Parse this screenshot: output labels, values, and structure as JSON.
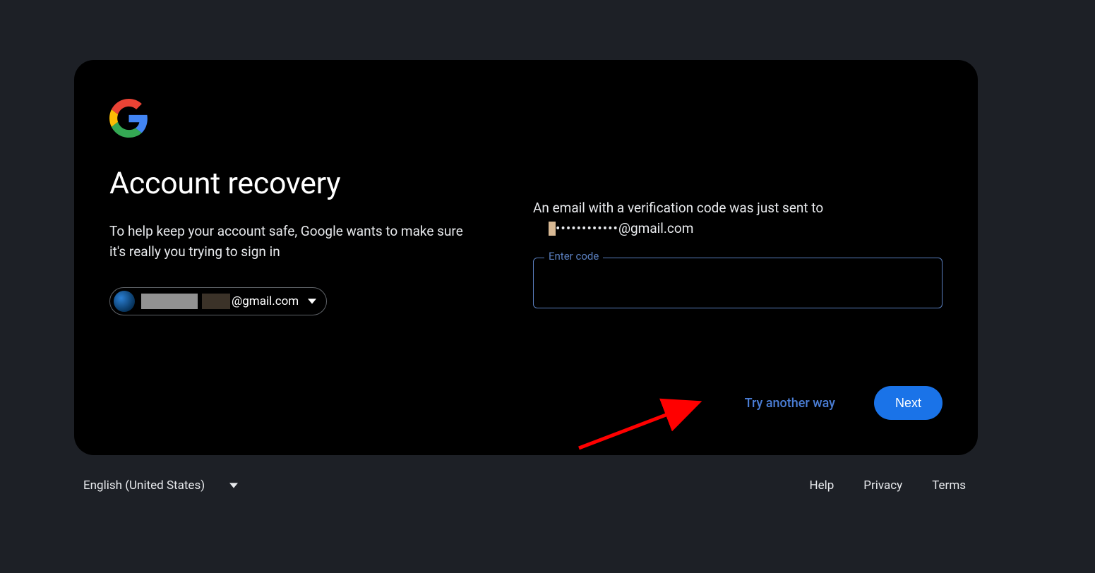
{
  "header": {
    "title": "Account recovery",
    "subtitle": "To help keep your account safe, Google wants to make sure it's really you trying to sign in"
  },
  "account_chip": {
    "email_domain": "@gmail.com"
  },
  "verification": {
    "instruction_prefix": "An email with a verification code was just sent to",
    "masked_dots": "••••••••••••",
    "masked_domain": "@gmail.com",
    "field_label": "Enter code"
  },
  "actions": {
    "try_another": "Try another way",
    "next": "Next"
  },
  "footer": {
    "language": "English (United States)",
    "links": {
      "help": "Help",
      "privacy": "Privacy",
      "terms": "Terms"
    }
  }
}
